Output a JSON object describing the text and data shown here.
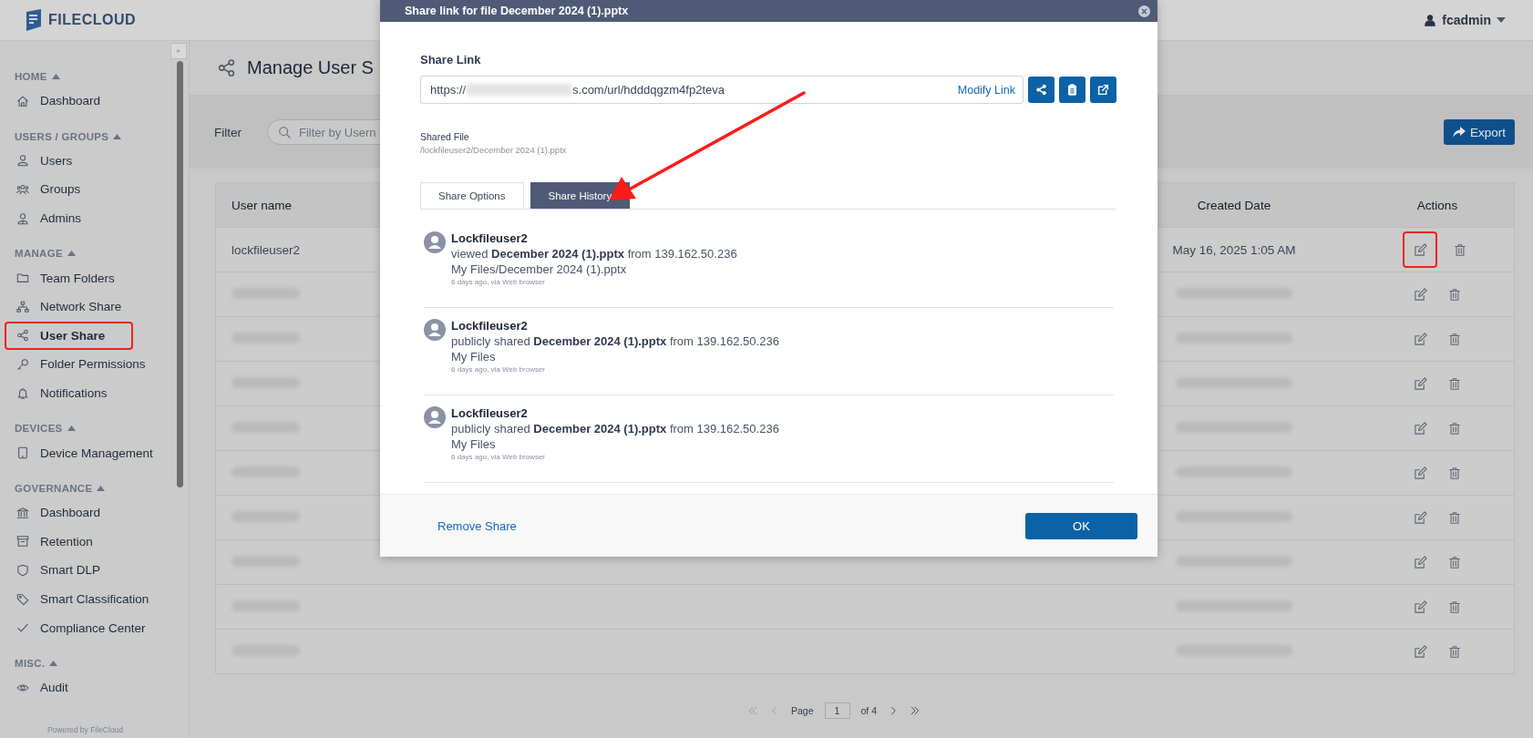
{
  "header": {
    "logo_text": "FILECLOUD",
    "user": "fcadmin"
  },
  "sidebar": {
    "sections": [
      {
        "title": "HOME",
        "expanded": true,
        "items": [
          {
            "label": "Dashboard",
            "kind": "home",
            "selected": false,
            "highlighted": false
          }
        ]
      },
      {
        "title": "USERS / GROUPS",
        "expanded": true,
        "items": [
          {
            "label": "Users",
            "kind": "user",
            "selected": false,
            "highlighted": false
          },
          {
            "label": "Groups",
            "kind": "group",
            "selected": false,
            "highlighted": false
          },
          {
            "label": "Admins",
            "kind": "admin",
            "selected": false,
            "highlighted": false
          }
        ]
      },
      {
        "title": "MANAGE",
        "expanded": true,
        "items": [
          {
            "label": "Team Folders",
            "kind": "folder",
            "selected": false,
            "highlighted": false
          },
          {
            "label": "Network Share",
            "kind": "network",
            "selected": false,
            "highlighted": false
          },
          {
            "label": "User Share",
            "kind": "share",
            "selected": true,
            "highlighted": true
          },
          {
            "label": "Folder Permissions",
            "kind": "key",
            "selected": false,
            "highlighted": false
          },
          {
            "label": "Notifications",
            "kind": "bell",
            "selected": false,
            "highlighted": false
          }
        ]
      },
      {
        "title": "DEVICES",
        "expanded": true,
        "items": [
          {
            "label": "Device Management",
            "kind": "tablet",
            "selected": false,
            "highlighted": false
          }
        ]
      },
      {
        "title": "GOVERNANCE",
        "expanded": true,
        "items": [
          {
            "label": "Dashboard",
            "kind": "bank",
            "selected": false,
            "highlighted": false
          },
          {
            "label": "Retention",
            "kind": "archive",
            "selected": false,
            "highlighted": false
          },
          {
            "label": "Smart DLP",
            "kind": "shield",
            "selected": false,
            "highlighted": false
          },
          {
            "label": "Smart Classification",
            "kind": "tag",
            "selected": false,
            "highlighted": false
          },
          {
            "label": "Compliance Center",
            "kind": "check",
            "selected": false,
            "highlighted": false
          }
        ]
      },
      {
        "title": "MISC.",
        "expanded": true,
        "items": [
          {
            "label": "Audit",
            "kind": "eye",
            "selected": false,
            "highlighted": false
          }
        ]
      }
    ],
    "footer": "Powered by FileCloud"
  },
  "page": {
    "title": "Manage User S",
    "filter_label": "Filter",
    "filter_placeholder": "Filter by Usern",
    "export_label": "Export"
  },
  "table": {
    "columns": [
      "User name",
      "Created Date",
      "Actions"
    ],
    "rows": [
      {
        "user_name": "lockfileuser2",
        "created_date": "May 16, 2025 1:05 AM",
        "blurred": false,
        "edit_highlighted": true
      },
      {
        "blurred": true,
        "edit_highlighted": false
      },
      {
        "blurred": true,
        "edit_highlighted": false
      },
      {
        "blurred": true,
        "edit_highlighted": false
      },
      {
        "blurred": true,
        "edit_highlighted": false
      },
      {
        "blurred": true,
        "edit_highlighted": false
      },
      {
        "blurred": true,
        "edit_highlighted": false
      },
      {
        "blurred": true,
        "edit_highlighted": false
      },
      {
        "blurred": true,
        "edit_highlighted": false
      },
      {
        "blurred": true,
        "edit_highlighted": false
      }
    ]
  },
  "pagination": {
    "label": "Page",
    "page": "1",
    "of": "of 4"
  },
  "dialog": {
    "title": "Share link for file December 2024 (1).pptx",
    "share_link_label": "Share Link",
    "url_prefix": "https://",
    "url_redacted": true,
    "url_suffix": "s.com/url/hdddqgzm4fp2teva",
    "modify_link": "Modify Link",
    "shared_file_label": "Shared File",
    "shared_file_path": "/lockfileuser2/December 2024 (1).pptx",
    "tabs": [
      {
        "label": "Share Options",
        "selected": false
      },
      {
        "label": "Share History",
        "selected": true
      }
    ],
    "history": [
      {
        "user": "Lockfileuser2",
        "action": "viewed **December 2024 (1).pptx** from 139.162.50.236",
        "path": "My Files/December 2024 (1).pptx",
        "time": "6 days ago, via Web browser"
      },
      {
        "user": "Lockfileuser2",
        "action": "publicly shared **December 2024 (1).pptx** from 139.162.50.236",
        "path": "My Files",
        "time": "6 days ago, via Web browser"
      },
      {
        "user": "Lockfileuser2",
        "action": "publicly shared **December 2024 (1).pptx** from 139.162.50.236",
        "path": "My Files",
        "time": "6 days ago, via Web browser"
      }
    ],
    "remove_share": "Remove Share",
    "ok": "OK"
  },
  "annotation_arrow": true
}
